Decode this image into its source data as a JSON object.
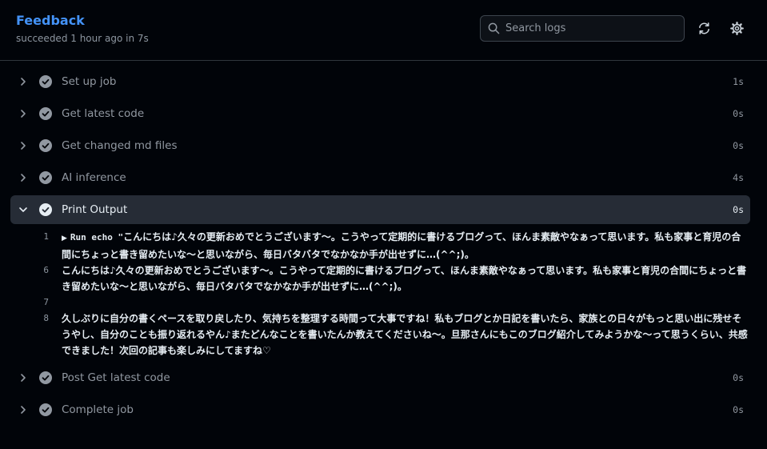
{
  "job": {
    "title": "Feedback",
    "status": "succeeded 1 hour ago in 7s"
  },
  "search": {
    "placeholder": "Search logs"
  },
  "steps_before": [
    {
      "label": "Set up job",
      "duration": "1s"
    },
    {
      "label": "Get latest code",
      "duration": "0s"
    },
    {
      "label": "Get changed md files",
      "duration": "0s"
    },
    {
      "label": "AI inference",
      "duration": "4s"
    }
  ],
  "expanded_step": {
    "label": "Print Output",
    "duration": "0s"
  },
  "log_lines": [
    {
      "num": "1",
      "prefix": "Run echo \"",
      "text": "こんにちは♪久々の更新おめでとうございます〜。こうやって定期的に書けるブログって、ほんま素敵やなぁって思います。私も家事と育児の合間にちょっと書き留めたいな〜と思いながら、毎日バタバタでなかなか手が出せずに…(^^;)。"
    },
    {
      "num": "6",
      "prefix": "",
      "text": "こんにちは♪久々の更新おめでとうございます〜。こうやって定期的に書けるブログって、ほんま素敵やなぁって思います。私も家事と育児の合間にちょっと書き留めたいな〜と思いながら、毎日バタバタでなかなか手が出せずに…(^^;)。"
    },
    {
      "num": "7",
      "prefix": "",
      "text": ""
    },
    {
      "num": "8",
      "prefix": "",
      "text": "久しぶりに自分の書くペースを取り戻したり、気持ちを整理する時間って大事ですね！私もブログとか日記を書いたら、家族との日々がもっと思い出に残せそうやし、自分のことも振り返れるやん♪またどんなことを書いたんか教えてくださいね〜。旦那さんにもこのブログ紹介してみようかな〜って思うくらい、共感できました！次回の記事も楽しみにしてますね♡"
    }
  ],
  "steps_after": [
    {
      "label": "Post Get latest code",
      "duration": "0s"
    },
    {
      "label": "Complete job",
      "duration": "0s"
    }
  ],
  "colors": {
    "accent": "#4493f8",
    "background": "#010409",
    "expanded_row": "#262c36",
    "muted": "#9198a1"
  }
}
